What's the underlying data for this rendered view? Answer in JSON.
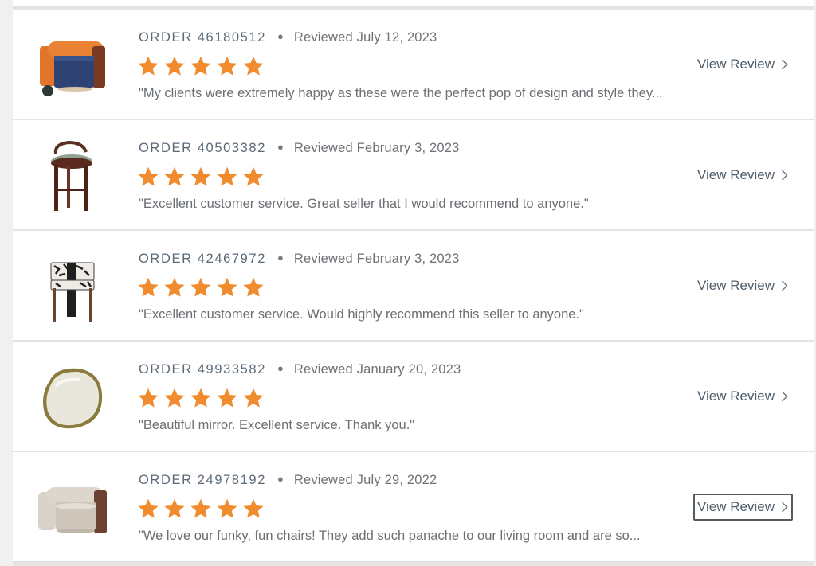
{
  "colors": {
    "star": "#f08c2e",
    "link": "#4f5d6a",
    "row_bg": "#ffffff",
    "page_bg": "#f0f0f0"
  },
  "icons": {
    "star": "star-icon",
    "chevron": "chevron-right-icon"
  },
  "reviews": [
    {
      "order_label": "ORDER 46180512",
      "reviewed": "Reviewed July 12, 2023",
      "rating": 5,
      "quote": "\"My clients were extremely happy as these were the perfect pop of design and style they...",
      "view_label": "View Review",
      "thumbnail": "orange-navy-lounge-chair"
    },
    {
      "order_label": "ORDER 40503382",
      "reviewed": "Reviewed February 3, 2023",
      "rating": 5,
      "quote": "\"Excellent customer service. Great seller that I would recommend to anyone.\"",
      "view_label": "View Review",
      "thumbnail": "green-seat-bar-stool"
    },
    {
      "order_label": "ORDER 42467972",
      "reviewed": "Reviewed February 3, 2023",
      "rating": 5,
      "quote": "\"Excellent customer service. Would highly recommend this seller to anyone.\"",
      "view_label": "View Review",
      "thumbnail": "patterned-counter-stool"
    },
    {
      "order_label": "ORDER 49933582",
      "reviewed": "Reviewed January 20, 2023",
      "rating": 5,
      "quote": "\"Beautiful mirror. Excellent service. Thank you.\"",
      "view_label": "View Review",
      "thumbnail": "round-brass-mirror"
    },
    {
      "order_label": "ORDER 24978192",
      "reviewed": "Reviewed July 29, 2022",
      "rating": 5,
      "quote": "\"We love our funky, fun chairs! They add such panache to our living room and are so...",
      "view_label": "View Review",
      "thumbnail": "cream-lounge-chair",
      "focused": true
    }
  ]
}
